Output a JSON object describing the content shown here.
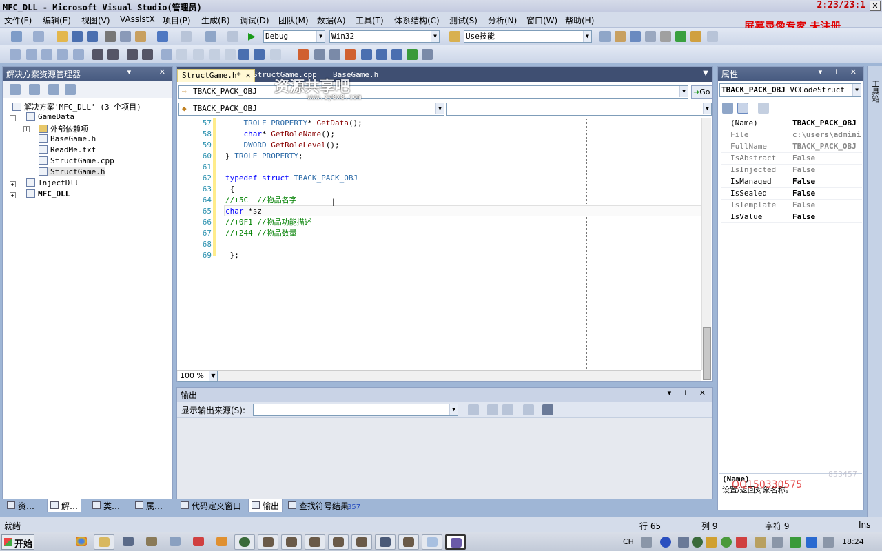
{
  "window": {
    "title": "MFC_DLL - Microsoft Visual Studio(管理员)",
    "clock": "2:23/23:1",
    "recorder_label": "屏幕录像专家  未注册"
  },
  "menu": [
    "文件(F)",
    "编辑(E)",
    "视图(V)",
    "VAssistX",
    "项目(P)",
    "生成(B)",
    "调试(D)",
    "团队(M)",
    "数据(A)",
    "工具(T)",
    "体系结构(C)",
    "测试(S)",
    "分析(N)",
    "窗口(W)",
    "帮助(H)"
  ],
  "toolbar": {
    "config": "Debug",
    "platform": "Win32",
    "find_combo": "Use技能"
  },
  "solution_explorer": {
    "title": "解决方案资源管理器",
    "items": [
      {
        "label": "解决方案'MFC_DLL' (3 个项目)"
      },
      {
        "label": "GameData"
      },
      {
        "label": "外部依赖项"
      },
      {
        "label": "BaseGame.h"
      },
      {
        "label": "ReadMe.txt"
      },
      {
        "label": "StructGame.cpp"
      },
      {
        "label": "StructGame.h"
      },
      {
        "label": "InjectDll"
      },
      {
        "label": "MFC_DLL"
      }
    ]
  },
  "left_tabs": [
    "资…",
    "解…",
    "类…",
    "属…"
  ],
  "editor": {
    "tabs": [
      {
        "label": "StructGame.h*",
        "active": true
      },
      {
        "label": "StructGame.cpp",
        "active": false
      },
      {
        "label": "BaseGame.h",
        "active": false
      }
    ],
    "nav_combo": "TBACK_PACK_OBJ",
    "go_label": "Go",
    "scope_combo": "TBACK_PACK_OBJ",
    "member_combo": "",
    "zoom": "100 %",
    "lines": [
      {
        "num": "57",
        "text": "    TROLE_PROPERTY* GetData();"
      },
      {
        "num": "58",
        "text": "    char* GetRoleName();"
      },
      {
        "num": "59",
        "text": "    DWORD GetRoleLevel();"
      },
      {
        "num": "60",
        "text": "}_TROLE_PROPERTY;"
      },
      {
        "num": "61",
        "text": ""
      },
      {
        "num": "62",
        "text": "typedef struct TBACK_PACK_OBJ"
      },
      {
        "num": "63",
        "text": " {"
      },
      {
        "num": "64",
        "text": "//+5C  //物品名字"
      },
      {
        "num": "65",
        "text": "char *sz"
      },
      {
        "num": "66",
        "text": "//+0F1 //物品功能描述"
      },
      {
        "num": "67",
        "text": "//+244 //物品数量"
      },
      {
        "num": "68",
        "text": ""
      },
      {
        "num": "69",
        "text": " };"
      }
    ]
  },
  "output": {
    "title": "输出",
    "source_label": "显示输出来源(S):",
    "source_value": ""
  },
  "bottom_tabs": [
    "代码定义窗口",
    "输出",
    "查找符号结果"
  ],
  "overlay_text": {
    "watermark_site": "资源共享吧",
    "watermark_url": "www.zy8x8.com",
    "qq": "QQ150330575",
    "faint": "853457",
    "tab_num": "357"
  },
  "properties": {
    "title": "属性",
    "object_name": "TBACK_PACK_OBJ",
    "object_type": "VCCodeStruct",
    "rows": [
      {
        "name": "(Name)",
        "value": "TBACK_PACK_OBJ",
        "bold": true
      },
      {
        "name": "File",
        "value": "c:\\users\\admini",
        "bold": false
      },
      {
        "name": "FullName",
        "value": "TBACK_PACK_OBJ",
        "bold": false
      },
      {
        "name": "IsAbstract",
        "value": "False",
        "bold": false
      },
      {
        "name": "IsInjected",
        "value": "False",
        "bold": false
      },
      {
        "name": "IsManaged",
        "value": "False",
        "bold": true
      },
      {
        "name": "IsSealed",
        "value": "False",
        "bold": true
      },
      {
        "name": "IsTemplate",
        "value": "False",
        "bold": false
      },
      {
        "name": "IsValue",
        "value": "False",
        "bold": true
      }
    ],
    "desc_title": "(Name)",
    "desc_text": "设置/返回对象名称。"
  },
  "side_strip_label": "工具箱",
  "status": {
    "ready": "就绪",
    "row": "行 65",
    "col": "列 9",
    "char": "字符 9",
    "mode": "Ins"
  },
  "taskbar": {
    "start": "开始",
    "lang": "CH",
    "time": "18:24"
  }
}
